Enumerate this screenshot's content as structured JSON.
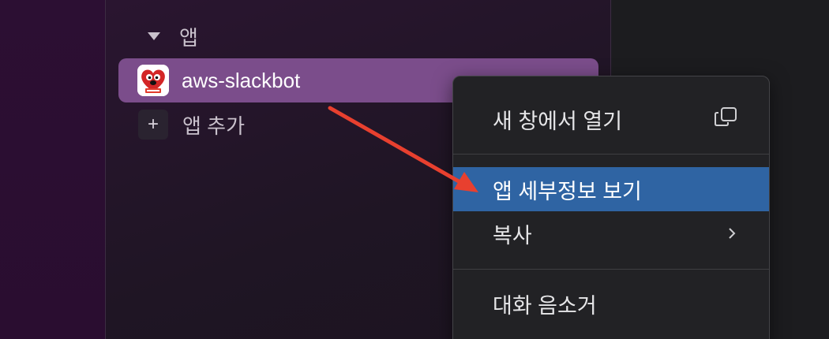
{
  "sidebar": {
    "section_title": "앱",
    "app_item": {
      "label": "aws-slackbot",
      "icon": "heart-mascot-icon"
    },
    "add_app_label": "앱 추가"
  },
  "context_menu": {
    "items": [
      {
        "label": "새 창에서 열기",
        "icon": "open-new-window-icon"
      },
      {
        "label": "앱 세부정보 보기",
        "highlighted": true
      },
      {
        "label": "복사",
        "icon": "chevron-right-icon"
      },
      {
        "label": "대화 음소거"
      }
    ]
  },
  "colors": {
    "selected_row": "#7b4d8b",
    "menu_highlight": "#2f64a3",
    "annotation_arrow": "#e8402f"
  }
}
